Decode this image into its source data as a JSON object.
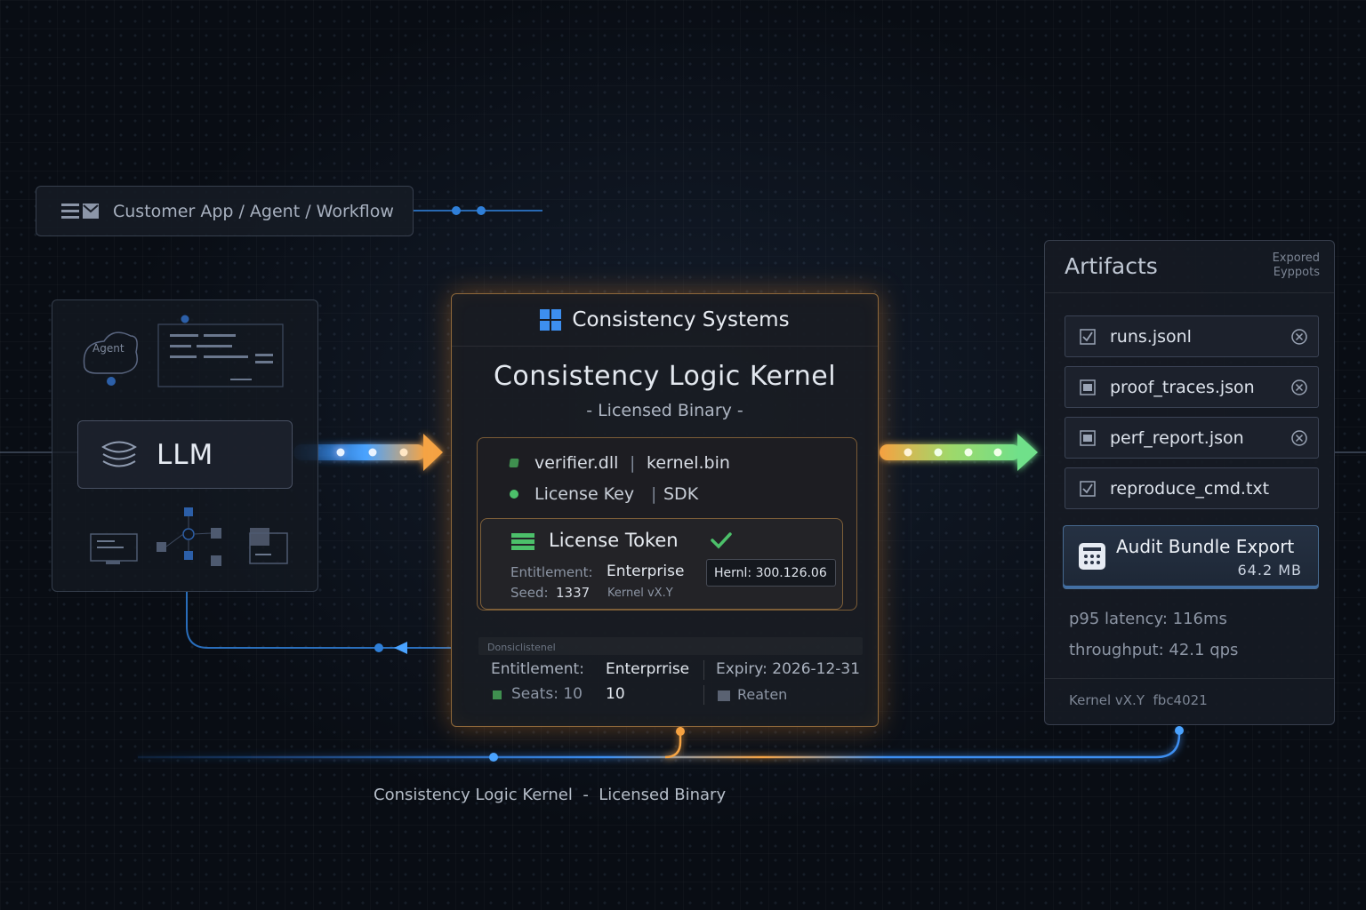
{
  "customer": {
    "label": "Customer App / Agent / Workflow"
  },
  "left": {
    "agent_label": "Agent",
    "llm_label": "LLM"
  },
  "center": {
    "brand": "Consistency Systems",
    "title": "Consistency Logic Kernel",
    "subtitle": "- Licensed Binary -",
    "files_line1_a": "verifier.dll",
    "files_line1_sep": "|",
    "files_line1_b": "kernel.bin",
    "files_line2_a": "License Key",
    "files_line2_sep": "|",
    "files_line2_b": "SDK",
    "token": {
      "title": "License Token",
      "entitlement_label": "Entitlement:",
      "entitlement_value": "Enterprise",
      "kernel_pill": "Hernl: 300.126.06",
      "seed_label": "Seed:",
      "seed_value": "1337",
      "kernel_version": "Kernel vX.Y"
    },
    "sub_header": "Donsiclistenel",
    "lower": {
      "entitlement_label": "Entitlement:",
      "entitlement_value": "Enterprrise",
      "expiry": "Expiry: 2026-12-31",
      "seats_label": "Seats: 10",
      "seats_value": "10",
      "reaten": "Reaten"
    }
  },
  "artifacts": {
    "title": "Artifacts",
    "exported_line1": "Expored",
    "exported_line2": "Eyppots",
    "files": [
      "runs.jsonl",
      "proof_traces.json",
      "perf_report.json",
      "reproduce_cmd.txt"
    ],
    "audit_title": "Audit Bundle Export",
    "audit_size": "64.2 MB",
    "p95": "p95 latency: 116ms",
    "throughput": "throughput: 42.1 qps",
    "kernel_footer": "Kernel vX.Y  fbc4021"
  },
  "footer": {
    "caption": "Consistency Logic Kernel  -  Licensed Binary"
  },
  "colors": {
    "accent_orange": "#f5a445",
    "accent_blue": "#4aa3ff",
    "accent_green": "#6fe08a",
    "check_green": "#4cc06a"
  },
  "icons": [
    "list-icon",
    "mail-icon",
    "llm-layers-icon",
    "windows-logo-icon",
    "license-token-icon",
    "check-icon",
    "checkbox-icon",
    "close-circle-icon",
    "calculator-icon",
    "seat-icon",
    "reaten-icon"
  ]
}
